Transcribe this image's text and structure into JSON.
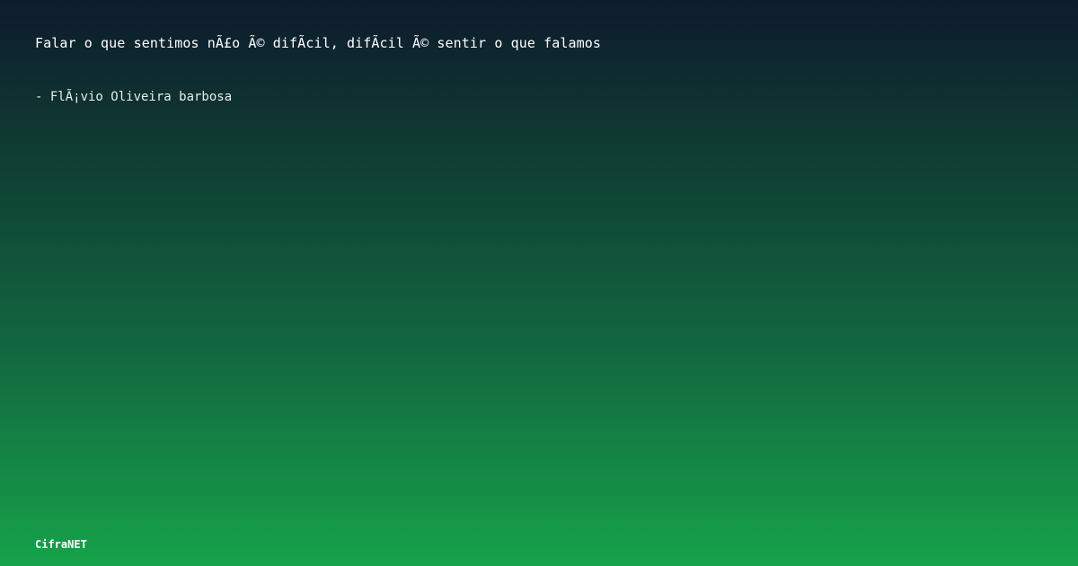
{
  "quote": {
    "text": "Falar o que sentimos nÃ£o Ã© difÃ­cil, difÃ­cil Ã© sentir o que falamos"
  },
  "author": {
    "text": "- FlÃ¡vio Oliveira barbosa"
  },
  "brand": {
    "name": "CifraNET"
  },
  "colors": {
    "gradient_top": "#0e1a2d",
    "gradient_bottom": "#16a24a",
    "text": "#ffffff"
  }
}
